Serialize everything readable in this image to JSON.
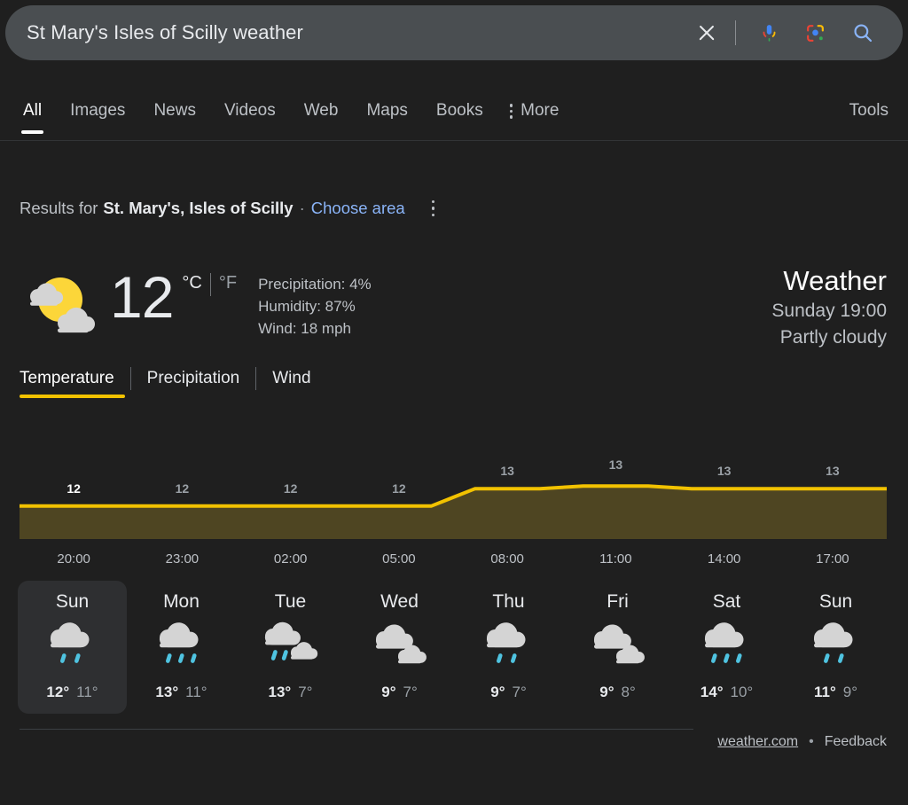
{
  "search": {
    "query": "St Mary's Isles of Scilly weather",
    "clear_icon": "close-icon",
    "mic_icon": "microphone-icon",
    "lens_icon": "google-lens-icon",
    "search_icon": "search-icon"
  },
  "nav": {
    "items": [
      {
        "label": "All",
        "active": true
      },
      {
        "label": "Images",
        "active": false
      },
      {
        "label": "News",
        "active": false
      },
      {
        "label": "Videos",
        "active": false
      },
      {
        "label": "Web",
        "active": false
      },
      {
        "label": "Maps",
        "active": false
      },
      {
        "label": "Books",
        "active": false
      }
    ],
    "more_label": "More",
    "tools_label": "Tools"
  },
  "results_for": {
    "label": "Results for",
    "place": "St. Mary's, Isles of Scilly",
    "separator": "·",
    "choose_area": "Choose area"
  },
  "current": {
    "icon": "partly-cloudy-icon",
    "temperature": "12",
    "unit_c": "°C",
    "unit_f": "°F",
    "precipitation": "Precipitation: 4%",
    "humidity": "Humidity: 87%",
    "wind": "Wind: 18 mph",
    "title": "Weather",
    "datetime": "Sunday 19:00",
    "condition": "Partly cloudy"
  },
  "metric_tabs": [
    {
      "label": "Temperature",
      "active": true
    },
    {
      "label": "Precipitation",
      "active": false
    },
    {
      "label": "Wind",
      "active": false
    }
  ],
  "chart_data": {
    "type": "area",
    "title": "Temperature",
    "xlabel": "",
    "ylabel": "°C",
    "ylim": [
      11,
      14
    ],
    "grid": false,
    "legend": "none",
    "line_color": "#f2c200",
    "fill_color": "#4e4522",
    "x": [
      "20:00",
      "23:00",
      "02:00",
      "05:00",
      "08:00",
      "11:00",
      "14:00",
      "17:00"
    ],
    "categories": [
      "20:00",
      "23:00",
      "02:00",
      "05:00",
      "08:00",
      "11:00",
      "14:00",
      "17:00"
    ],
    "values": [
      12,
      12,
      12,
      12,
      13,
      13,
      13,
      13
    ],
    "point_labels": [
      "12",
      "12",
      "12",
      "12",
      "13",
      "13",
      "13",
      "13"
    ],
    "current_index": 0,
    "tick_labels": [
      "20:00",
      "23:00",
      "02:00",
      "05:00",
      "08:00",
      "11:00",
      "14:00",
      "17:00"
    ]
  },
  "forecast": {
    "days": [
      {
        "name": "Sun",
        "icon": "rain-icon",
        "drops": 2,
        "sun": false,
        "high": "12°",
        "low": "11°",
        "selected": true
      },
      {
        "name": "Mon",
        "icon": "rain-icon",
        "drops": 3,
        "sun": false,
        "high": "13°",
        "low": "11°",
        "selected": false
      },
      {
        "name": "Tue",
        "icon": "partly-cloudy-rain-icon",
        "drops": 2,
        "sun": true,
        "high": "13°",
        "low": "7°",
        "selected": false
      },
      {
        "name": "Wed",
        "icon": "cloudy-icon",
        "drops": 0,
        "sun": true,
        "high": "9°",
        "low": "7°",
        "selected": false
      },
      {
        "name": "Thu",
        "icon": "rain-icon",
        "drops": 2,
        "sun": false,
        "high": "9°",
        "low": "7°",
        "selected": false
      },
      {
        "name": "Fri",
        "icon": "cloudy-icon",
        "drops": 0,
        "sun": true,
        "high": "9°",
        "low": "8°",
        "selected": false
      },
      {
        "name": "Sat",
        "icon": "rain-icon",
        "drops": 3,
        "sun": false,
        "high": "14°",
        "low": "10°",
        "selected": false
      },
      {
        "name": "Sun",
        "icon": "rain-icon",
        "drops": 2,
        "sun": false,
        "high": "11°",
        "low": "9°",
        "selected": false
      }
    ]
  },
  "footer": {
    "source": "weather.com",
    "separator": "•",
    "feedback": "Feedback"
  },
  "colors": {
    "background": "#1f1f1f",
    "searchbar": "#4a4e51",
    "accent_yellow": "#f2c200",
    "chart_fill": "#4e4522",
    "link_blue": "#8ab4f8",
    "rain_blue": "#4fc3e0",
    "cloud_grey": "#d4d4d4",
    "sun_yellow": "#fcd639"
  }
}
